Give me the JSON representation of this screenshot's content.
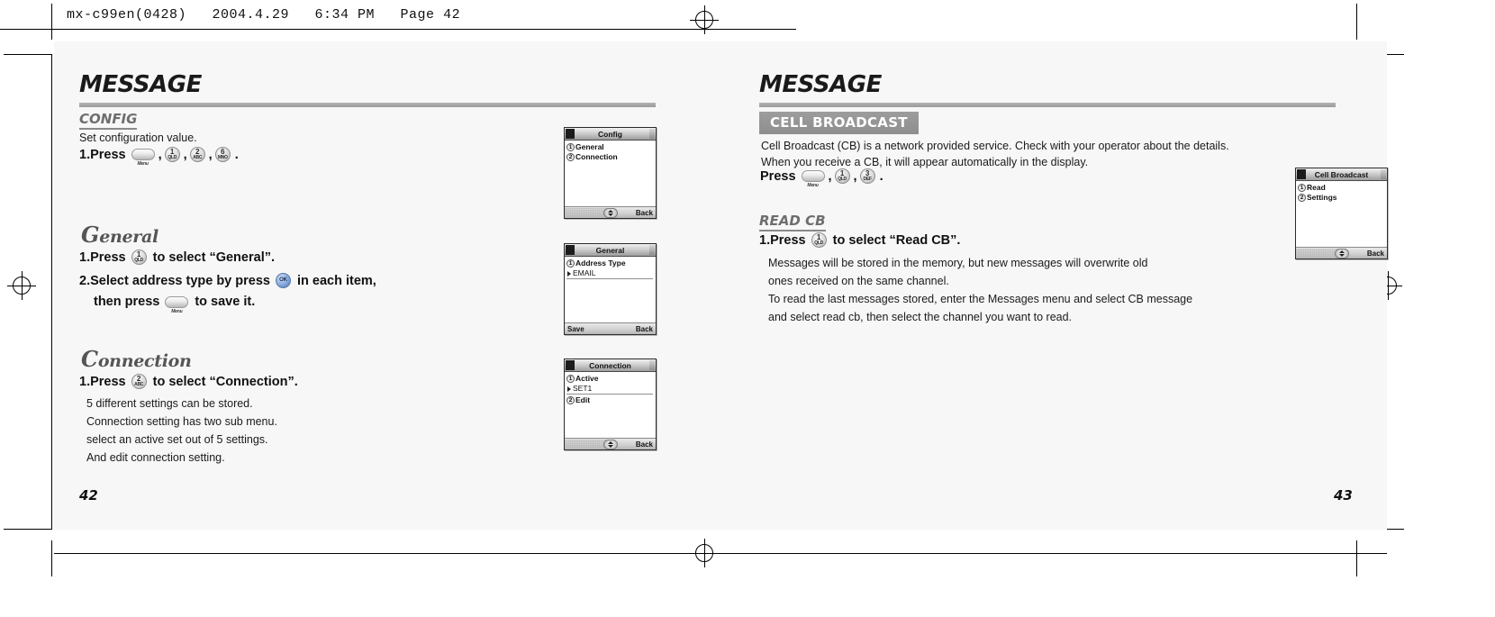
{
  "filestamp": "mx-c99en(0428)   2004.4.29   6:34 PM   Page 42",
  "left_page": {
    "chapter_title": "MESSAGE",
    "page_number": "42",
    "config": {
      "heading": "CONFIG",
      "intro": "Set configuration value.",
      "step1_prefix": "1.Press",
      "keys": [
        "Menu",
        "1",
        "2",
        "6"
      ],
      "key_subs": [
        "",
        "QLD",
        "ABC",
        "MNO"
      ],
      "comma": ",",
      "period": "."
    },
    "general": {
      "sub_head_cap": "G",
      "sub_head_rest": "eneral",
      "step1_prefix": "1.Press",
      "step1_key": "1",
      "step1_key_sub": "QLD",
      "step1_suffix": "to select “General”.",
      "step2_prefix": "2.Select address type by press",
      "step2_key": "OK",
      "step2_suffix": "in each item,",
      "step2_line2_prefix": "then press",
      "step2_line2_key": "Menu",
      "step2_line2_suffix": "to save it."
    },
    "connection": {
      "sub_head_cap": "C",
      "sub_head_rest": "onnection",
      "step1_prefix": "1.Press",
      "step1_key": "2",
      "step1_key_sub": "ABC",
      "step1_suffix": "to select “Connection”.",
      "notes": [
        "5 different settings can be stored.",
        "Connection setting has two sub menu.",
        "select an active set out of 5 settings.",
        "And edit connection setting."
      ]
    },
    "screens": [
      {
        "title": "Config",
        "rows": [
          {
            "num": "1",
            "label": "General"
          },
          {
            "num": "2",
            "label": "Connection"
          }
        ],
        "sub": null,
        "foot_left": "",
        "foot_right": "Back"
      },
      {
        "title": "General",
        "rows": [
          {
            "num": "1",
            "label": "Address Type"
          }
        ],
        "sub": "EMAIL",
        "foot_left": "Save",
        "foot_right": "Back"
      },
      {
        "title": "Connection",
        "rows": [
          {
            "num": "1",
            "label": "Active"
          }
        ],
        "sub": "SET1",
        "rows2": [
          {
            "num": "2",
            "label": "Edit"
          }
        ],
        "foot_left": "",
        "foot_right": "Back"
      }
    ]
  },
  "right_page": {
    "chapter_title": "MESSAGE",
    "page_number": "43",
    "cell_broadcast": {
      "band_heading": "CELL BROADCAST",
      "intro_line1": "Cell Broadcast (CB) is a network provided service. Check with your operator about the details.",
      "intro_line2": "When you receive a CB, it will appear automatically in the display.",
      "press_prefix": "Press",
      "keys": [
        "Menu",
        "1",
        "3"
      ],
      "key_subs": [
        "",
        "QLD",
        "DEF"
      ],
      "comma": ",",
      "period": "."
    },
    "read_cb": {
      "heading": "READ CB",
      "step1_prefix": "1.Press",
      "step1_key": "1",
      "step1_key_sub": "QLD",
      "step1_suffix": "to select “Read CB”.",
      "notes": [
        "Messages will be stored in the memory, but new messages will overwrite old",
        "ones received on the same channel.",
        "To read the last messages stored, enter the Messages menu and select CB message",
        "and select read cb, then select the channel you want to read."
      ]
    },
    "screens": [
      {
        "title": "Cell Broadcast",
        "rows": [
          {
            "num": "1",
            "label": "Read"
          },
          {
            "num": "2",
            "label": "Settings"
          }
        ],
        "sub": null,
        "foot_left": "",
        "foot_right": "Back"
      }
    ]
  }
}
